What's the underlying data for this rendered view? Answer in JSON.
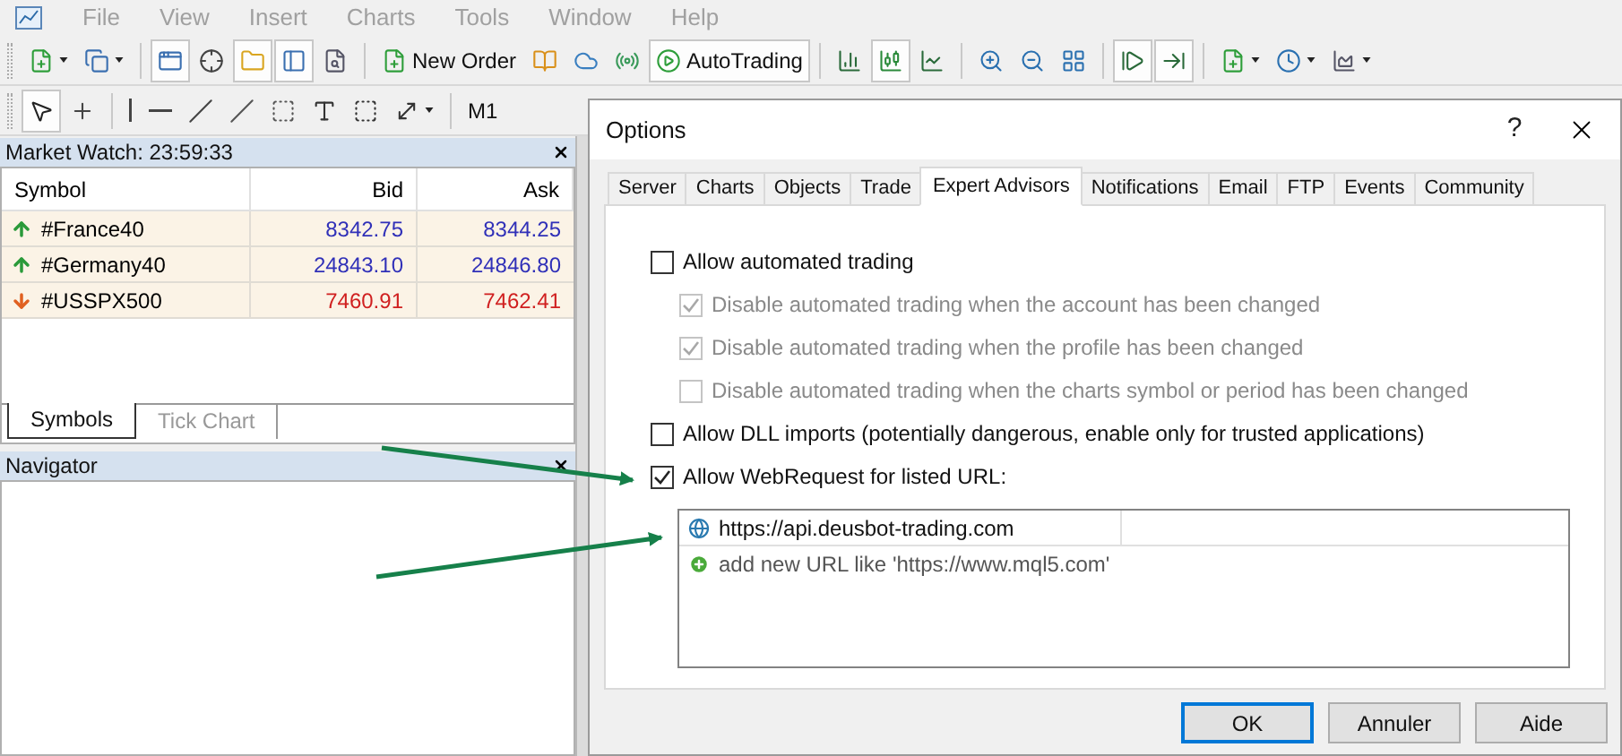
{
  "menu_bar": {
    "disabled": true,
    "items": [
      "File",
      "View",
      "Insert",
      "Charts",
      "Tools",
      "Window",
      "Help"
    ]
  },
  "toolbars": [
    {
      "items": [
        {
          "kind": "button",
          "pressed": false,
          "dropdown": true
        },
        {
          "kind": "button",
          "pressed": false,
          "dropdown": true
        },
        {
          "kind": "separator"
        },
        {
          "kind": "button",
          "pressed": true,
          "dropdown": false
        },
        {
          "kind": "button",
          "pressed": false,
          "dropdown": false
        },
        {
          "kind": "button",
          "pressed": true,
          "dropdown": false
        },
        {
          "kind": "button",
          "pressed": true,
          "dropdown": false
        },
        {
          "kind": "button",
          "pressed": false,
          "dropdown": false
        },
        {
          "kind": "separator"
        },
        {
          "kind": "labeled",
          "label": "New Order",
          "pressed": false,
          "dropdown": false
        },
        {
          "kind": "button",
          "pressed": false,
          "dropdown": false
        },
        {
          "kind": "button",
          "pressed": false,
          "dropdown": false
        },
        {
          "kind": "button",
          "pressed": false,
          "dropdown": false
        },
        {
          "kind": "labeled",
          "label": "AutoTrading",
          "pressed": true,
          "dropdown": false
        },
        {
          "kind": "separator"
        },
        {
          "kind": "button",
          "pressed": false,
          "dropdown": false
        },
        {
          "kind": "button",
          "pressed": true,
          "dropdown": false
        },
        {
          "kind": "button",
          "pressed": false,
          "dropdown": false
        },
        {
          "kind": "separator"
        },
        {
          "kind": "button",
          "pressed": false,
          "dropdown": false
        },
        {
          "kind": "button",
          "pressed": false,
          "dropdown": false
        },
        {
          "kind": "button",
          "pressed": false,
          "dropdown": false
        },
        {
          "kind": "separator"
        },
        {
          "kind": "button",
          "pressed": true,
          "dropdown": false
        },
        {
          "kind": "button",
          "pressed": true,
          "dropdown": false
        },
        {
          "kind": "separator"
        },
        {
          "kind": "button",
          "pressed": false,
          "dropdown": true
        },
        {
          "kind": "button",
          "pressed": false,
          "dropdown": true
        },
        {
          "kind": "button",
          "pressed": false,
          "dropdown": true
        }
      ]
    },
    {
      "items": [
        {
          "kind": "button",
          "pressed": true,
          "dropdown": false
        },
        {
          "kind": "button",
          "pressed": false,
          "dropdown": false
        },
        {
          "kind": "separator"
        },
        {
          "kind": "button",
          "pressed": false,
          "dropdown": false
        },
        {
          "kind": "button",
          "pressed": false,
          "dropdown": false
        },
        {
          "kind": "button",
          "pressed": false,
          "dropdown": false
        },
        {
          "kind": "button",
          "pressed": false,
          "dropdown": false
        },
        {
          "kind": "button",
          "pressed": false,
          "dropdown": false
        },
        {
          "kind": "button",
          "pressed": false,
          "dropdown": false
        },
        {
          "kind": "button",
          "pressed": false,
          "dropdown": false
        },
        {
          "kind": "button",
          "pressed": false,
          "dropdown": true
        },
        {
          "kind": "separator"
        },
        {
          "kind": "labeled",
          "label": "M1",
          "pressed": false,
          "dropdown": false
        }
      ]
    }
  ],
  "market_watch": {
    "title": "Market Watch: 23:59:33",
    "columns": [
      "Symbol",
      "Bid",
      "Ask"
    ],
    "rows": [
      {
        "symbol": "#France40",
        "bid": "8342.75",
        "ask": "8344.25",
        "rising": true
      },
      {
        "symbol": "#Germany40",
        "bid": "24843.10",
        "ask": "24846.80",
        "rising": true
      },
      {
        "symbol": "#USSPX500",
        "bid": "7460.91",
        "ask": "7462.41",
        "rising": false
      }
    ],
    "tabs": [
      {
        "label": "Symbols",
        "selected": true
      },
      {
        "label": "Tick Chart",
        "selected": false
      }
    ]
  },
  "navigator": {
    "title": "Navigator"
  },
  "dialog": {
    "title": "Options",
    "help": "?",
    "tabs": [
      {
        "label": "Server",
        "selected": false
      },
      {
        "label": "Charts",
        "selected": false
      },
      {
        "label": "Objects",
        "selected": false
      },
      {
        "label": "Trade",
        "selected": false
      },
      {
        "label": "Expert Advisors",
        "selected": true
      },
      {
        "label": "Notifications",
        "selected": false
      },
      {
        "label": "Email",
        "selected": false
      },
      {
        "label": "FTP",
        "selected": false
      },
      {
        "label": "Events",
        "selected": false
      },
      {
        "label": "Community",
        "selected": false
      }
    ],
    "options": [
      {
        "label": "Allow automated trading",
        "checked": false,
        "disabled": false,
        "children": [
          {
            "label": "Disable automated trading when the account has been changed",
            "checked": true,
            "disabled": true
          },
          {
            "label": "Disable automated trading when the profile has been changed",
            "checked": true,
            "disabled": true
          },
          {
            "label": "Disable automated trading when the charts symbol or period has been changed",
            "checked": false,
            "disabled": true
          }
        ]
      },
      {
        "label": "Allow DLL imports (potentially dangerous, enable only for trusted applications)",
        "checked": false,
        "disabled": false
      },
      {
        "label": "Allow WebRequest for listed URL:",
        "checked": true,
        "disabled": false
      }
    ],
    "url_list": [
      {
        "kind": "url",
        "text": "https://api.deusbot-trading.com"
      },
      {
        "kind": "add",
        "text": "add new URL like 'https://www.mql5.com'"
      }
    ],
    "buttons": [
      {
        "label": "OK",
        "default": true
      },
      {
        "label": "Annuler",
        "default": false
      },
      {
        "label": "Aide",
        "default": false
      }
    ]
  }
}
